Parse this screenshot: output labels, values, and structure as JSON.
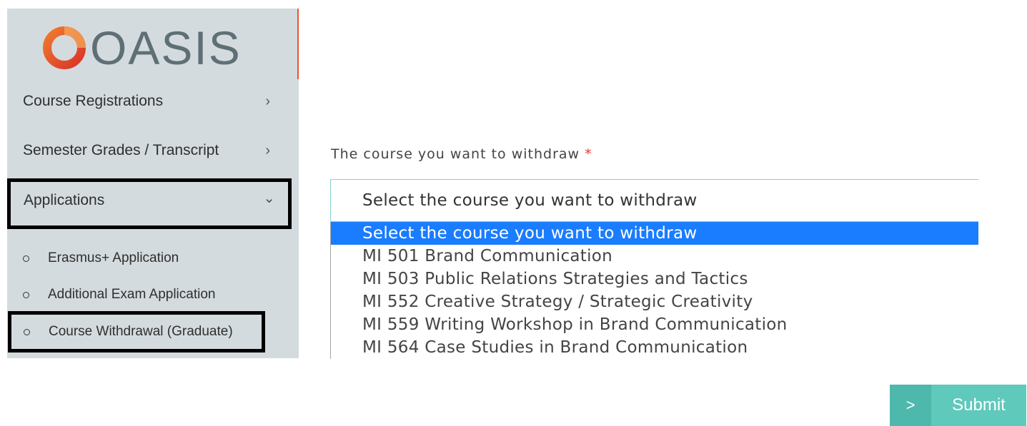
{
  "brand": {
    "name": "OASIS",
    "accent": "#e8552d"
  },
  "sidebar": {
    "items": [
      {
        "label": "Course Registrations",
        "chevron": "›"
      },
      {
        "label": "Semester Grades / Transcript",
        "chevron": "›"
      },
      {
        "label": "Applications",
        "chevron": "⌄"
      }
    ],
    "subitems": [
      {
        "label": "Erasmus+ Application"
      },
      {
        "label": "Additional Exam Application"
      },
      {
        "label": "Course Withdrawal (Graduate)"
      }
    ]
  },
  "form": {
    "label": "The course you want to withdraw",
    "required_mark": "*",
    "select_value": "Select the course you want to withdraw",
    "options": [
      "Select the course you want to withdraw",
      "MI 501 Brand Communication",
      "MI 503 Public Relations Strategies and Tactics",
      "MI 552 Creative Strategy / Strategic Creativity",
      "MI 559 Writing Workshop in Brand Communication",
      "MI 564 Case Studies in Brand Communication"
    ],
    "submit_label": "Submit",
    "submit_icon": ">"
  }
}
